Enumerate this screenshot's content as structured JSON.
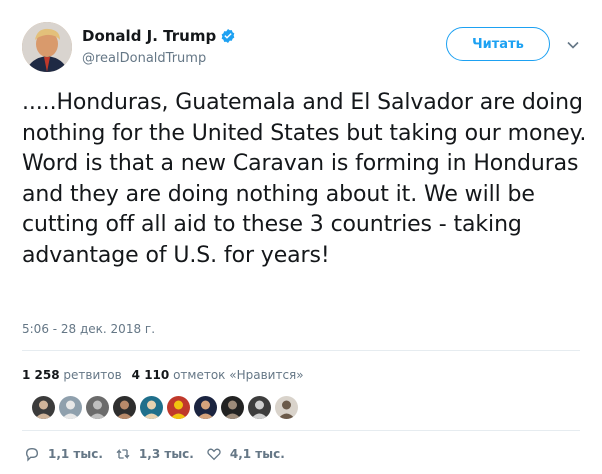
{
  "tweet": {
    "author": {
      "display_name": "Donald J. Trump",
      "handle": "@realDonaldTrump",
      "verified_icon": "verified-badge-icon"
    },
    "follow_button": "Читать",
    "text": ".....Honduras, Guatemala and El Salvador are doing nothing for the United States but taking our money. Word is that a new Caravan is forming in Honduras and they are doing nothing about it. We will be cutting off all aid to these 3 countries - taking advantage of U.S. for years!",
    "timestamp": "5:06 - 28 дек. 2018 г.",
    "stats": {
      "retweets_count": "1 258",
      "retweets_label": "ретвитов",
      "likes_count": "4 110",
      "likes_label": "отметок «Нравится»"
    },
    "liker_count": 10,
    "actions": {
      "replies": "1,1 тыс.",
      "retweets": "1,3 тыс.",
      "likes": "4,1 тыс."
    }
  },
  "colors": {
    "accent": "#1da1f2",
    "text": "#14171a",
    "muted": "#657786",
    "divider": "#e6ecf0"
  }
}
